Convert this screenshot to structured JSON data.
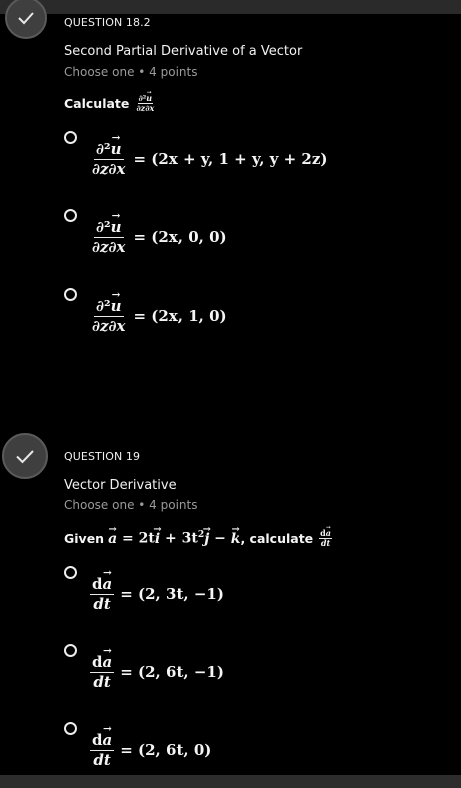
{
  "questions": [
    {
      "label": "QUESTION 18.2",
      "title": "Second Partial Derivative of a Vector",
      "meta": "Choose one • 4 points",
      "prompt": "Calculate",
      "options": [
        {
          "rhs": "= (2x + y, 1 + y, y + 2z)"
        },
        {
          "rhs": "= (2x, 0, 0)"
        },
        {
          "rhs": "= (2x, 1, 0)"
        }
      ]
    },
    {
      "label": "QUESTION 19",
      "title": "Vector Derivative",
      "meta": "Choose one • 4 points",
      "prompt_pre": "Given",
      "prompt_mid": ", calculate",
      "options": [
        {
          "rhs": "= (2, 3t, −1)"
        },
        {
          "rhs": "= (2, 6t, −1)"
        },
        {
          "rhs": "= (2, 6t, 0)"
        }
      ]
    }
  ],
  "colors": {
    "background": "#000000",
    "check_circle": "#3f3f3f",
    "text": "#e8e8e8",
    "muted": "#9a9a9a"
  },
  "icons": {
    "answered": "checkmark-icon",
    "option": "radio-circle"
  }
}
